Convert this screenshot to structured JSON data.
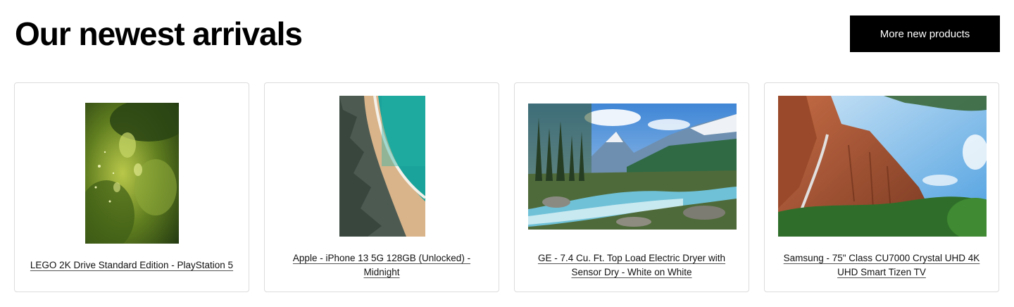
{
  "section": {
    "title": "Our newest arrivals",
    "more_button": "More new products"
  },
  "products": [
    {
      "title": "LEGO 2K Drive Standard Edition - PlayStation 5",
      "image": "forest-leaves-photo"
    },
    {
      "title": "Apple - iPhone 13 5G 128GB (Unlocked) - Midnight",
      "image": "aerial-beach-photo"
    },
    {
      "title": "GE - 7.4 Cu. Ft. Top Load Electric Dryer with Sensor Dry - White on White",
      "image": "mountain-river-photo"
    },
    {
      "title": "Samsung - 75\" Class CU7000 Crystal UHD 4K UHD Smart Tizen TV",
      "image": "red-cliff-waterfall-photo"
    }
  ],
  "colors": {
    "button_bg": "#000000",
    "button_text": "#ffffff",
    "card_border": "#dcdcdc"
  }
}
